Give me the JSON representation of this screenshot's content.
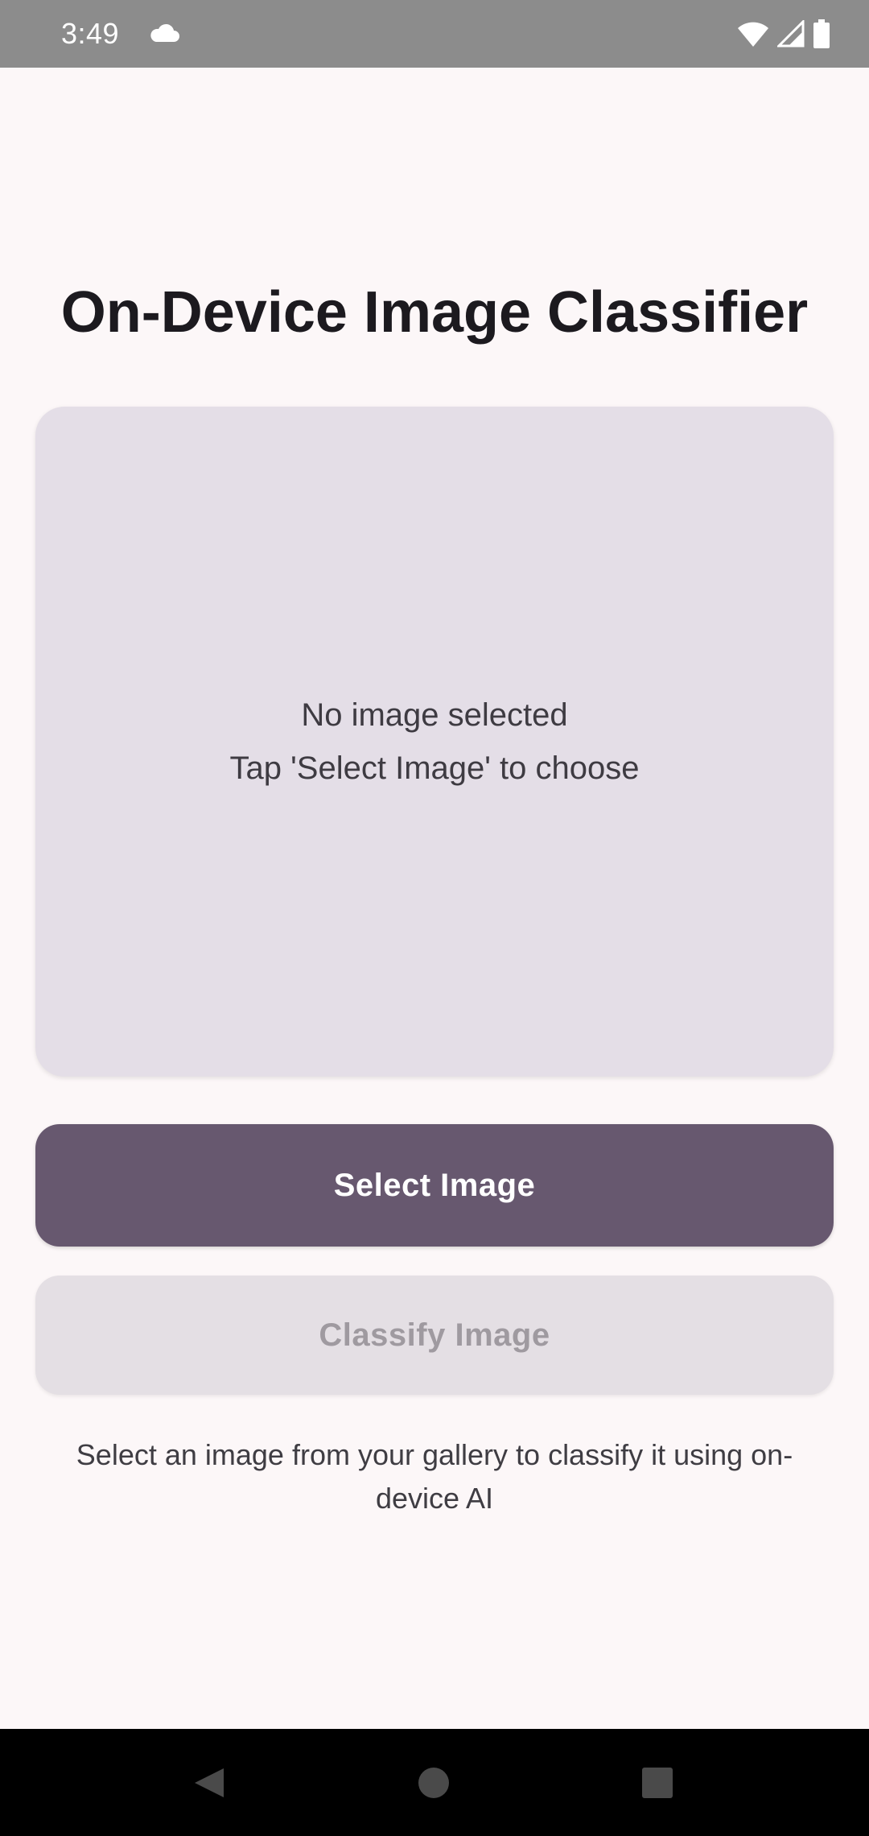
{
  "status_bar": {
    "time": "3:49",
    "icons": [
      "cloud-icon",
      "wifi-icon",
      "cell-signal-icon",
      "battery-icon"
    ]
  },
  "app": {
    "title": "On-Device Image Classifier"
  },
  "image_panel": {
    "line1": "No image selected",
    "line2": "Tap 'Select Image' to choose"
  },
  "buttons": {
    "select_label": "Select Image",
    "classify_label": "Classify Image"
  },
  "help": {
    "text": "Select an image from your gallery to classify it using on-device AI"
  },
  "nav_bar": {
    "icons": [
      "back-icon",
      "home-icon",
      "recents-icon"
    ]
  },
  "colors": {
    "background": "#fcf7f8",
    "panel": "#e4dee7",
    "primary_button": "#67586f",
    "disabled_button": "#e4dfe4",
    "status_bar": "#8c8c8c",
    "nav_bar": "#000000"
  }
}
